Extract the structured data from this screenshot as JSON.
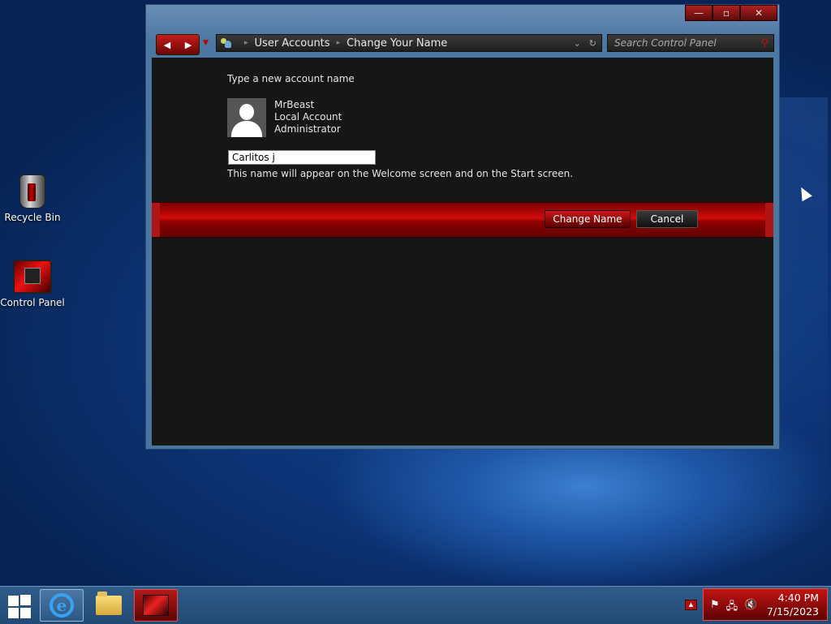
{
  "desktop": {
    "icons": [
      {
        "label": "Recycle Bin"
      },
      {
        "label": "Control Panel"
      }
    ]
  },
  "window": {
    "caption": {
      "minimize": "—",
      "maximize": "▫",
      "close": "✕"
    },
    "nav": {
      "back": "◀",
      "forward": "▶",
      "history": "▼"
    },
    "breadcrumb": [
      "User Accounts",
      "Change Your Name"
    ],
    "address_dropdown": "⌄",
    "refresh": "↻",
    "search": {
      "placeholder": "Search Control Panel"
    },
    "content": {
      "prompt": "Type a new account name",
      "account": {
        "name": "MrBeast",
        "type": "Local Account",
        "role": "Administrator"
      },
      "new_name_value": "Carlitos j",
      "hint": "This name will appear on the Welcome screen and on the Start screen.",
      "buttons": {
        "change_name": "Change Name",
        "cancel": "Cancel"
      }
    }
  },
  "taskbar": {
    "apps": [
      {
        "name": "Internet Explorer",
        "icon": "ie-icon"
      },
      {
        "name": "File Explorer",
        "icon": "folder-icon"
      },
      {
        "name": "Control Panel",
        "icon": "control-panel-icon"
      }
    ],
    "tray": {
      "show_hidden": "▲",
      "icons": [
        "flag-icon",
        "network-icon",
        "volume-muted-icon"
      ],
      "time": "4:40 PM",
      "date": "7/15/2023"
    }
  },
  "colors": {
    "accent_red": "#d40b0b",
    "window_frame": "#4a75a0",
    "content_bg": "#161616"
  }
}
